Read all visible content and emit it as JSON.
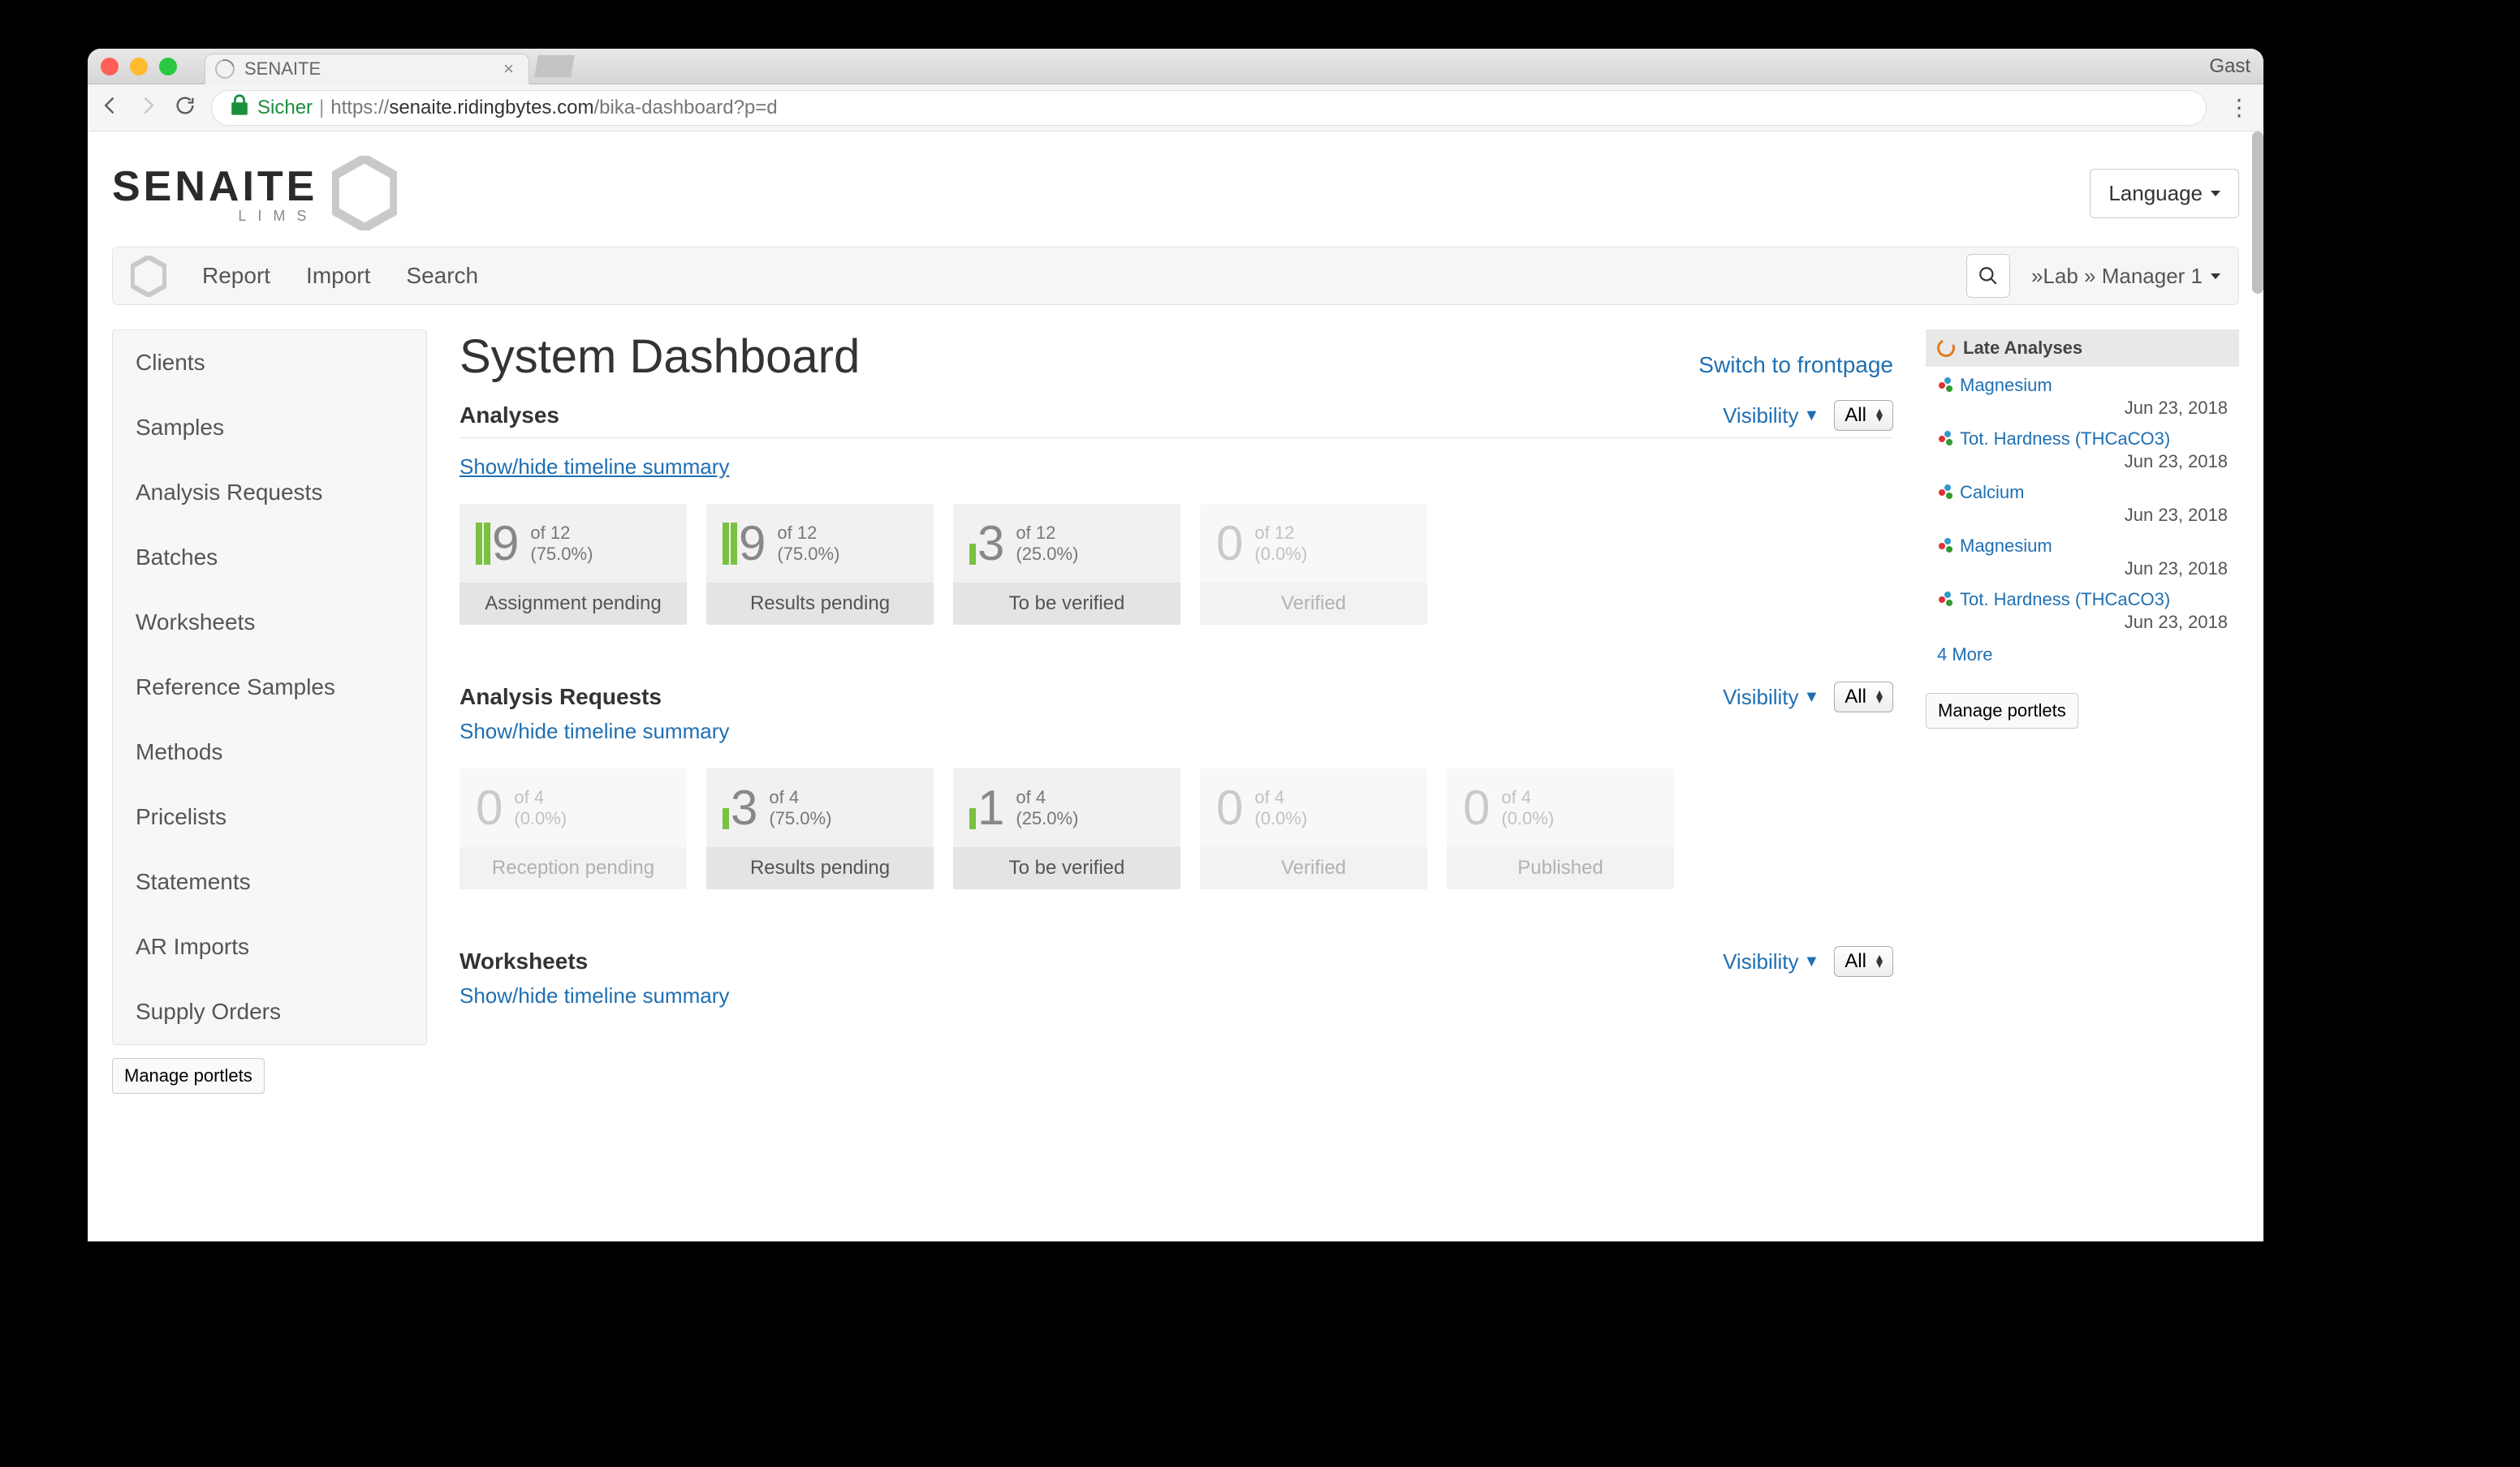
{
  "browser": {
    "tab_title": "SENAITE",
    "guest": "Gast",
    "secure_label": "Sicher",
    "url_display_prefix": "https://",
    "url_host": "senaite.ridingbytes.com",
    "url_path": "/bika-dashboard?p=d"
  },
  "logo": {
    "main": "SENAITE",
    "sub": "LIMS"
  },
  "language_button": "Language",
  "topnav": {
    "report": "Report",
    "import": "Import",
    "search": "Search",
    "user": "»Lab » Manager 1"
  },
  "sidebar": {
    "items": [
      "Clients",
      "Samples",
      "Analysis Requests",
      "Batches",
      "Worksheets",
      "Reference Samples",
      "Methods",
      "Pricelists",
      "Statements",
      "AR Imports",
      "Supply Orders"
    ],
    "manage": "Manage portlets"
  },
  "main": {
    "title": "System Dashboard",
    "switch_link": "Switch to frontpage",
    "visibility_label": "Visibility",
    "filter_value": "All",
    "toggle_text": "Show/hide timeline summary",
    "sections": [
      {
        "title": "Analyses",
        "toggle_underlined": true,
        "cards": [
          {
            "num": "9",
            "bars": [
              true,
              true
            ],
            "of": "of 12",
            "pct": "(75.0%)",
            "label": "Assignment pending",
            "faded": false
          },
          {
            "num": "9",
            "bars": [
              true,
              true
            ],
            "of": "of 12",
            "pct": "(75.0%)",
            "label": "Results pending",
            "faded": false
          },
          {
            "num": "3",
            "bars": [
              true,
              false
            ],
            "of": "of 12",
            "pct": "(25.0%)",
            "label": "To be verified",
            "faded": false
          },
          {
            "num": "0",
            "bars": [],
            "of": "of 12",
            "pct": "(0.0%)",
            "label": "Verified",
            "faded": true
          }
        ]
      },
      {
        "title": "Analysis Requests",
        "toggle_underlined": false,
        "cards": [
          {
            "num": "0",
            "bars": [],
            "of": "of 4",
            "pct": "(0.0%)",
            "label": "Reception pending",
            "faded": true
          },
          {
            "num": "3",
            "bars": [
              true,
              true
            ],
            "of": "of 4",
            "pct": "(75.0%)",
            "label": "Results pending",
            "faded": false
          },
          {
            "num": "1",
            "bars": [
              true,
              false
            ],
            "of": "of 4",
            "pct": "(25.0%)",
            "label": "To be verified",
            "faded": false
          },
          {
            "num": "0",
            "bars": [],
            "of": "of 4",
            "pct": "(0.0%)",
            "label": "Verified",
            "faded": true
          },
          {
            "num": "0",
            "bars": [],
            "of": "of 4",
            "pct": "(0.0%)",
            "label": "Published",
            "faded": true
          }
        ]
      },
      {
        "title": "Worksheets",
        "toggle_underlined": false,
        "cards": []
      }
    ]
  },
  "right": {
    "portlet_title": "Late Analyses",
    "items": [
      {
        "name": "Magnesium",
        "date": "Jun 23, 2018"
      },
      {
        "name": "Tot. Hardness (THCaCO3)",
        "date": "Jun 23, 2018"
      },
      {
        "name": "Calcium",
        "date": "Jun 23, 2018"
      },
      {
        "name": "Magnesium",
        "date": "Jun 23, 2018"
      },
      {
        "name": "Tot. Hardness (THCaCO3)",
        "date": "Jun 23, 2018"
      }
    ],
    "more": "4 More",
    "manage": "Manage portlets"
  }
}
